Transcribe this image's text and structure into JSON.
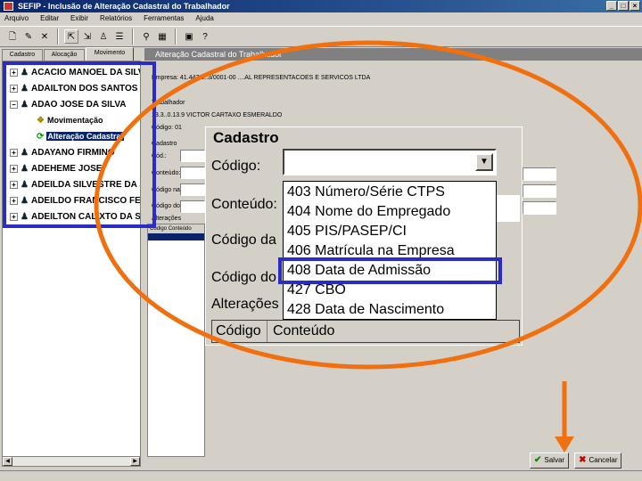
{
  "window": {
    "title": "SEFIP - Inclusão de Alteração Cadastral do Trabalhador",
    "min": "_",
    "max": "□",
    "close": "×"
  },
  "menu": [
    "Arquivo",
    "Editar",
    "Exibir",
    "Relatórios",
    "Ferramentas",
    "Ajuda"
  ],
  "tabs": [
    "Cadastro",
    "Alocação",
    "Movimento"
  ],
  "tree": {
    "items": [
      {
        "label": "ACACIO MANOEL DA SILVA"
      },
      {
        "label": "ADAILTON DOS SANTOS FERR"
      },
      {
        "label": "ADAO JOSE DA SILVA"
      },
      {
        "label": "Movimentação"
      },
      {
        "label": "Alteração Cadastral"
      },
      {
        "label": "ADAYANO FIRMINO"
      },
      {
        "label": "ADEHEME JOSE"
      },
      {
        "label": "ADEILDA SILVESTRE DA SILVA"
      },
      {
        "label": "ADEILDO FRANCISCO FELIX"
      },
      {
        "label": "ADEILTON CALIXTO DA SILVA"
      }
    ]
  },
  "main": {
    "header": "Alteração Cadastral do Trabalhador",
    "empresa": "Empresa: 41.447.3..3/0001-00 ....AL REPRESENTACOES E SERVICOS LTDA",
    "trabalhador_label": "Trabalhador",
    "trabalhador": "13.3..0.13.9 VICTOR CARTAXO ESMERALDO",
    "codigo_line": "Código: 01",
    "cadastro_label": "Cadastro",
    "cod_short": "Cód.:",
    "conteudo_short": "Conteúdo:",
    "cod_empresa": "Código na Empresa:",
    "cod_trab": "Código do Trabalhador:",
    "alteracoes": "Alterações",
    "col_codigo": "Código",
    "col_conteudo": "Conteúdo"
  },
  "zoom": {
    "title": "Cadastro",
    "codigo": "Código:",
    "conteudo": "Conteúdo:",
    "codigo_da": "Código da",
    "codigo_do": "Código do",
    "alteracoes": "Alterações",
    "col_codigo": "Código",
    "col_conteudo": "Conteúdo",
    "options": [
      "403 Número/Série CTPS",
      "404 Nome do Empregado",
      "405 PIS/PASEP/CI",
      "406 Matrícula na Empresa",
      "408 Data de Admissão",
      "427 CBO",
      "428 Data de Nascimento"
    ],
    "selected": "408 Data de Admissão"
  },
  "buttons": {
    "salvar": "Salvar",
    "cancelar": "Cancelar"
  },
  "colors": {
    "highlight": "#2b2bc8",
    "annotation": "#f07010",
    "selection": "#0a246a"
  }
}
